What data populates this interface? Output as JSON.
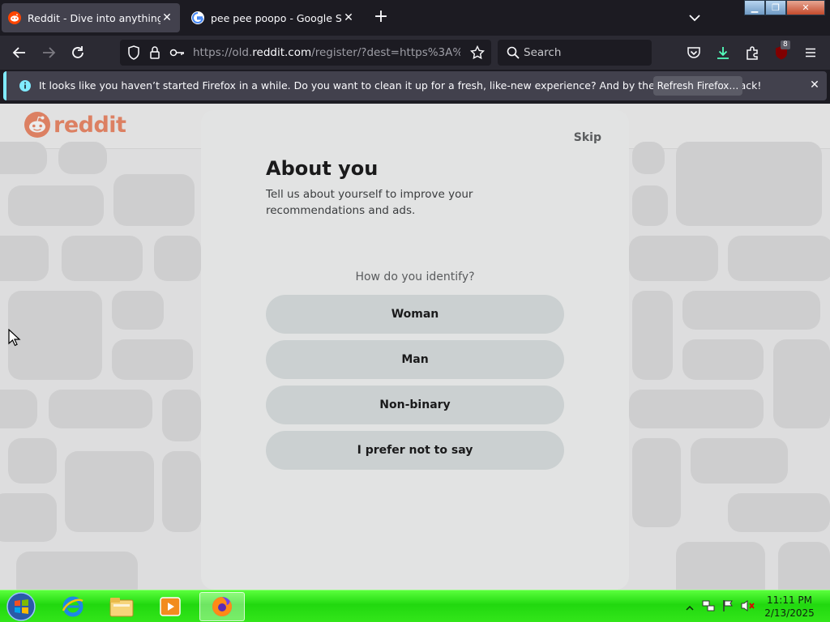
{
  "browser": {
    "tabs": [
      {
        "title": "Reddit - Dive into anything",
        "active": true,
        "favicon": "reddit-icon"
      },
      {
        "title": "pee pee poopo - Google Search",
        "active": false,
        "favicon": "google-icon"
      }
    ],
    "url": {
      "prefix": "https://old.",
      "domain": "reddit.com",
      "path": "/register/?dest=https%3A%2F%"
    },
    "search_placeholder": "Search",
    "extension_badge": "8"
  },
  "notification": {
    "message": "It looks like you haven’t started Firefox in a while. Do you want to clean it up for a fresh, like-new experience? And by the way, welcome back!",
    "button_label": "Refresh Firefox…"
  },
  "page": {
    "logo_text": "reddit",
    "modal": {
      "skip_label": "Skip",
      "title": "About you",
      "description": "Tell us about yourself to improve your recommendations and ads.",
      "question": "How do you identify?",
      "options": [
        "Woman",
        "Man",
        "Non-binary",
        "I prefer not to say"
      ]
    }
  },
  "taskbar": {
    "time": "11:11 PM",
    "date": "2/13/2025"
  },
  "colors": {
    "reddit_orange": "#e65a2b",
    "taskbar_green": "#21d80f",
    "firefox_dark": "#1c1b22"
  }
}
